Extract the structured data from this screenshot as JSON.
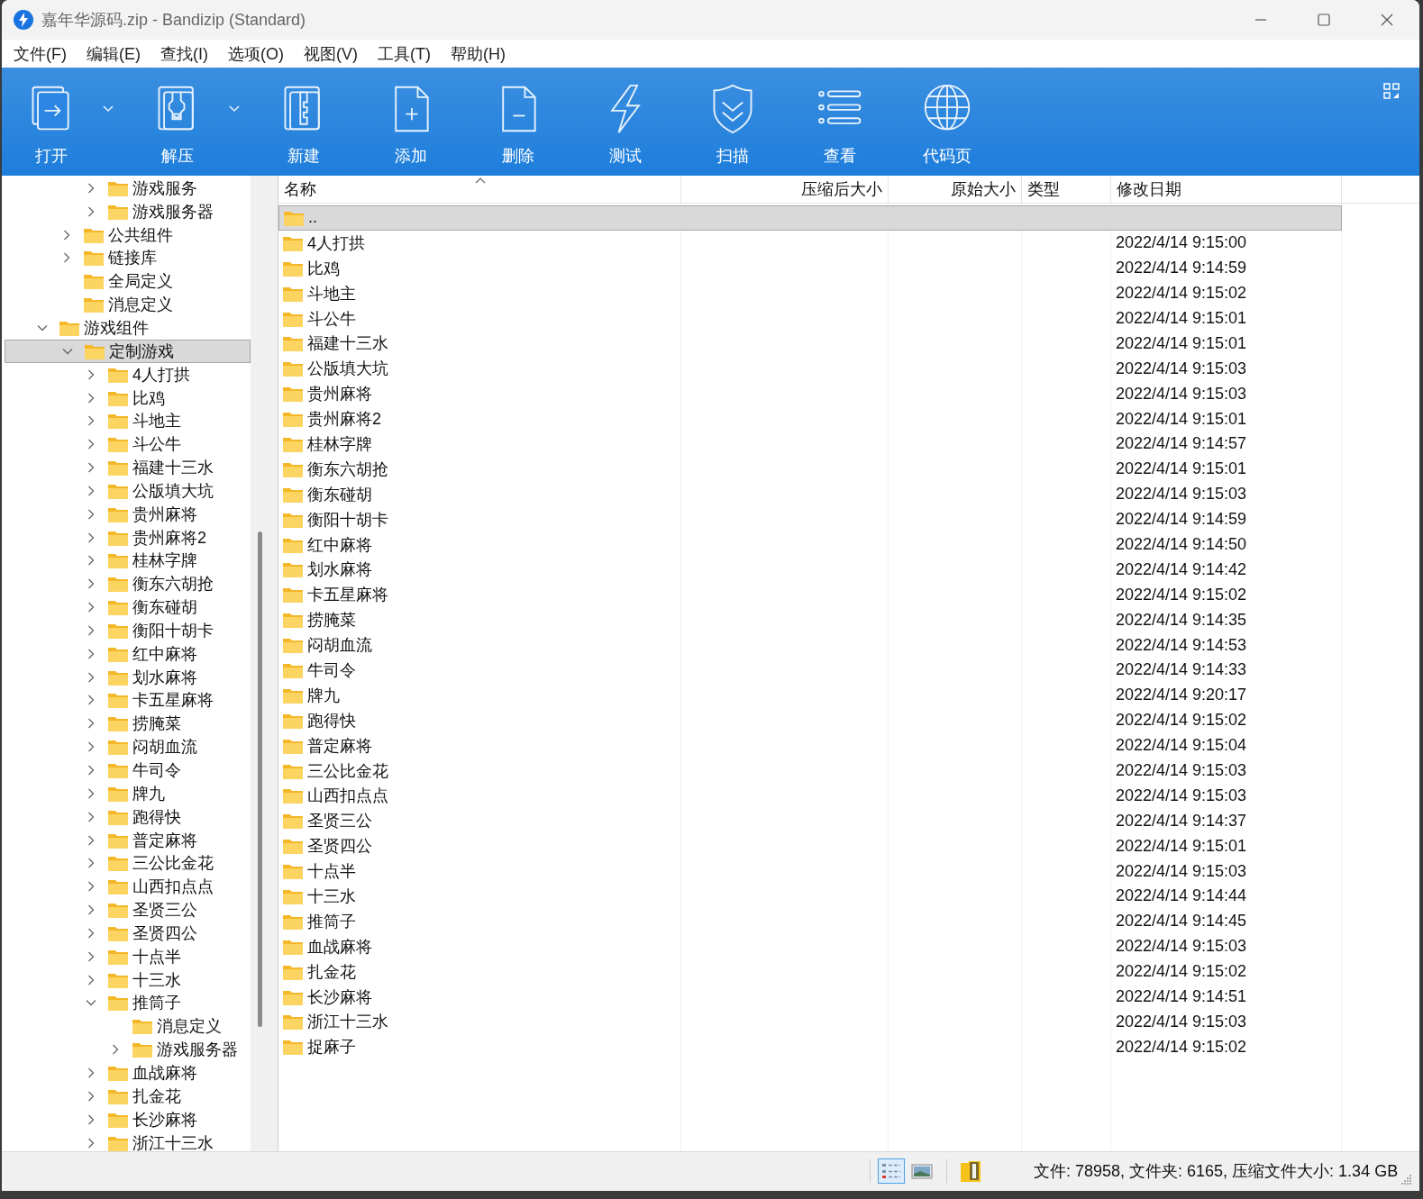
{
  "window": {
    "title": "嘉年华源码.zip - Bandizip (Standard)"
  },
  "menu": [
    "文件(F)",
    "编辑(E)",
    "查找(I)",
    "选项(O)",
    "视图(V)",
    "工具(T)",
    "帮助(H)"
  ],
  "toolbar": [
    {
      "label": "打开",
      "has_dropdown": true
    },
    {
      "label": "解压",
      "has_dropdown": true
    },
    {
      "label": "新建",
      "has_dropdown": false
    },
    {
      "label": "添加",
      "has_dropdown": false
    },
    {
      "label": "删除",
      "has_dropdown": false
    },
    {
      "label": "测试",
      "has_dropdown": false
    },
    {
      "label": "扫描",
      "has_dropdown": false
    },
    {
      "label": "查看",
      "has_dropdown": false
    },
    {
      "label": "代码页",
      "has_dropdown": false
    }
  ],
  "tree": {
    "items": [
      {
        "children": [
          {
            "children": [
              {
                "label": "游戏服务",
                "has_children": true,
                "expanded": false,
                "selected": false
              },
              {
                "label": "游戏服务器",
                "has_children": true,
                "expanded": false,
                "selected": false
              }
            ]
          },
          {
            "label": "公共组件",
            "has_children": true,
            "expanded": false,
            "selected": false
          },
          {
            "label": "链接库",
            "has_children": true,
            "expanded": false,
            "selected": false
          },
          {
            "label": "全局定义",
            "has_children": false,
            "selected": false
          },
          {
            "label": "消息定义",
            "has_children": false,
            "selected": false
          }
        ]
      },
      {
        "label": "游戏组件",
        "has_children": true,
        "expanded": true,
        "selected": false,
        "children": [
          {
            "label": "定制游戏",
            "has_children": true,
            "expanded": true,
            "selected": true,
            "children": [
              {
                "label": "4人打拱",
                "has_children": true,
                "expanded": false,
                "selected": false
              },
              {
                "label": "比鸡",
                "has_children": true,
                "expanded": false,
                "selected": false
              },
              {
                "label": "斗地主",
                "has_children": true,
                "expanded": false,
                "selected": false
              },
              {
                "label": "斗公牛",
                "has_children": true,
                "expanded": false,
                "selected": false
              },
              {
                "label": "福建十三水",
                "has_children": true,
                "expanded": false,
                "selected": false
              },
              {
                "label": "公版填大坑",
                "has_children": true,
                "expanded": false,
                "selected": false
              },
              {
                "label": "贵州麻将",
                "has_children": true,
                "expanded": false,
                "selected": false
              },
              {
                "label": "贵州麻将2",
                "has_children": true,
                "expanded": false,
                "selected": false
              },
              {
                "label": "桂林字牌",
                "has_children": true,
                "expanded": false,
                "selected": false
              },
              {
                "label": "衡东六胡抢",
                "has_children": true,
                "expanded": false,
                "selected": false
              },
              {
                "label": "衡东碰胡",
                "has_children": true,
                "expanded": false,
                "selected": false
              },
              {
                "label": "衡阳十胡卡",
                "has_children": true,
                "expanded": false,
                "selected": false
              },
              {
                "label": "红中麻将",
                "has_children": true,
                "expanded": false,
                "selected": false
              },
              {
                "label": "划水麻将",
                "has_children": true,
                "expanded": false,
                "selected": false
              },
              {
                "label": "卡五星麻将",
                "has_children": true,
                "expanded": false,
                "selected": false
              },
              {
                "label": "捞腌菜",
                "has_children": true,
                "expanded": false,
                "selected": false
              },
              {
                "label": "闷胡血流",
                "has_children": true,
                "expanded": false,
                "selected": false
              },
              {
                "label": "牛司令",
                "has_children": true,
                "expanded": false,
                "selected": false
              },
              {
                "label": "牌九",
                "has_children": true,
                "expanded": false,
                "selected": false
              },
              {
                "label": "跑得快",
                "has_children": true,
                "expanded": false,
                "selected": false
              },
              {
                "label": "普定麻将",
                "has_children": true,
                "expanded": false,
                "selected": false
              },
              {
                "label": "三公比金花",
                "has_children": true,
                "expanded": false,
                "selected": false
              },
              {
                "label": "山西扣点点",
                "has_children": true,
                "expanded": false,
                "selected": false
              },
              {
                "label": "圣贤三公",
                "has_children": true,
                "expanded": false,
                "selected": false
              },
              {
                "label": "圣贤四公",
                "has_children": true,
                "expanded": false,
                "selected": false
              },
              {
                "label": "十点半",
                "has_children": true,
                "expanded": false,
                "selected": false
              },
              {
                "label": "十三水",
                "has_children": true,
                "expanded": false,
                "selected": false
              },
              {
                "label": "推筒子",
                "has_children": true,
                "expanded": true,
                "selected": false,
                "children": [
                  {
                    "label": "消息定义",
                    "has_children": false,
                    "selected": false
                  },
                  {
                    "label": "游戏服务器",
                    "has_children": true,
                    "expanded": false,
                    "selected": false
                  }
                ]
              },
              {
                "label": "血战麻将",
                "has_children": true,
                "expanded": false,
                "selected": false
              },
              {
                "label": "扎金花",
                "has_children": true,
                "expanded": false,
                "selected": false
              },
              {
                "label": "长沙麻将",
                "has_children": true,
                "expanded": false,
                "selected": false
              },
              {
                "label": "浙江十三水",
                "has_children": true,
                "expanded": false,
                "selected": false
              }
            ]
          }
        ]
      }
    ]
  },
  "table": {
    "columns": [
      "名称",
      "压缩后大小",
      "原始大小",
      "类型",
      "修改日期"
    ],
    "rows": [
      {
        "name": "..",
        "modified": "",
        "selected": true
      },
      {
        "name": "4人打拱",
        "modified": "2022/4/14 9:15:00",
        "selected": false
      },
      {
        "name": "比鸡",
        "modified": "2022/4/14 9:14:59",
        "selected": false
      },
      {
        "name": "斗地主",
        "modified": "2022/4/14 9:15:02",
        "selected": false
      },
      {
        "name": "斗公牛",
        "modified": "2022/4/14 9:15:01",
        "selected": false
      },
      {
        "name": "福建十三水",
        "modified": "2022/4/14 9:15:01",
        "selected": false
      },
      {
        "name": "公版填大坑",
        "modified": "2022/4/14 9:15:03",
        "selected": false
      },
      {
        "name": "贵州麻将",
        "modified": "2022/4/14 9:15:03",
        "selected": false
      },
      {
        "name": "贵州麻将2",
        "modified": "2022/4/14 9:15:01",
        "selected": false
      },
      {
        "name": "桂林字牌",
        "modified": "2022/4/14 9:14:57",
        "selected": false
      },
      {
        "name": "衡东六胡抢",
        "modified": "2022/4/14 9:15:01",
        "selected": false
      },
      {
        "name": "衡东碰胡",
        "modified": "2022/4/14 9:15:03",
        "selected": false
      },
      {
        "name": "衡阳十胡卡",
        "modified": "2022/4/14 9:14:59",
        "selected": false
      },
      {
        "name": "红中麻将",
        "modified": "2022/4/14 9:14:50",
        "selected": false
      },
      {
        "name": "划水麻将",
        "modified": "2022/4/14 9:14:42",
        "selected": false
      },
      {
        "name": "卡五星麻将",
        "modified": "2022/4/14 9:15:02",
        "selected": false
      },
      {
        "name": "捞腌菜",
        "modified": "2022/4/14 9:14:35",
        "selected": false
      },
      {
        "name": "闷胡血流",
        "modified": "2022/4/14 9:14:53",
        "selected": false
      },
      {
        "name": "牛司令",
        "modified": "2022/4/14 9:14:33",
        "selected": false
      },
      {
        "name": "牌九",
        "modified": "2022/4/14 9:20:17",
        "selected": false
      },
      {
        "name": "跑得快",
        "modified": "2022/4/14 9:15:02",
        "selected": false
      },
      {
        "name": "普定麻将",
        "modified": "2022/4/14 9:15:04",
        "selected": false
      },
      {
        "name": "三公比金花",
        "modified": "2022/4/14 9:15:03",
        "selected": false
      },
      {
        "name": "山西扣点点",
        "modified": "2022/4/14 9:15:03",
        "selected": false
      },
      {
        "name": "圣贤三公",
        "modified": "2022/4/14 9:14:37",
        "selected": false
      },
      {
        "name": "圣贤四公",
        "modified": "2022/4/14 9:15:01",
        "selected": false
      },
      {
        "name": "十点半",
        "modified": "2022/4/14 9:15:03",
        "selected": false
      },
      {
        "name": "十三水",
        "modified": "2022/4/14 9:14:44",
        "selected": false
      },
      {
        "name": "推筒子",
        "modified": "2022/4/14 9:14:45",
        "selected": false
      },
      {
        "name": "血战麻将",
        "modified": "2022/4/14 9:15:03",
        "selected": false
      },
      {
        "name": "扎金花",
        "modified": "2022/4/14 9:15:02",
        "selected": false
      },
      {
        "name": "长沙麻将",
        "modified": "2022/4/14 9:14:51",
        "selected": false
      },
      {
        "name": "浙江十三水",
        "modified": "2022/4/14 9:15:03",
        "selected": false
      },
      {
        "name": "捉麻子",
        "modified": "2022/4/14 9:15:02",
        "selected": false
      }
    ]
  },
  "status_bar": {
    "views": [
      {
        "selected": true
      },
      {
        "selected": false
      }
    ],
    "text": "文件: 78958, 文件夹: 6165, 压缩文件大小: 1.34 GB"
  }
}
